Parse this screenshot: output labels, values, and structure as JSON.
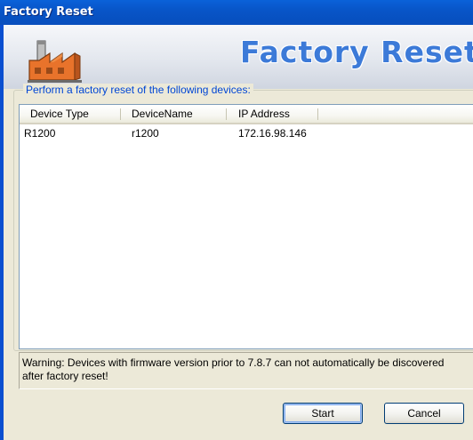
{
  "window": {
    "title": "Factory Reset"
  },
  "banner": {
    "title": "Factory Reset",
    "icon": "factory-icon"
  },
  "group": {
    "label": "Perform a factory reset of the following devices:"
  },
  "table": {
    "columns": [
      "Device Type",
      "DeviceName",
      "IP Address"
    ],
    "rows": [
      [
        "R1200",
        "r1200",
        "172.16.98.146"
      ]
    ]
  },
  "warning": {
    "text": "Warning: Devices with firmware version prior to 7.8.7 can not automatically be discovered after factory reset!"
  },
  "buttons": {
    "start": "Start",
    "cancel": "Cancel"
  },
  "colors": {
    "titlebar": "#0855c8",
    "banner_title": "#3c7ad8",
    "group_label": "#0046d5",
    "window_bg": "#ece9d8"
  }
}
